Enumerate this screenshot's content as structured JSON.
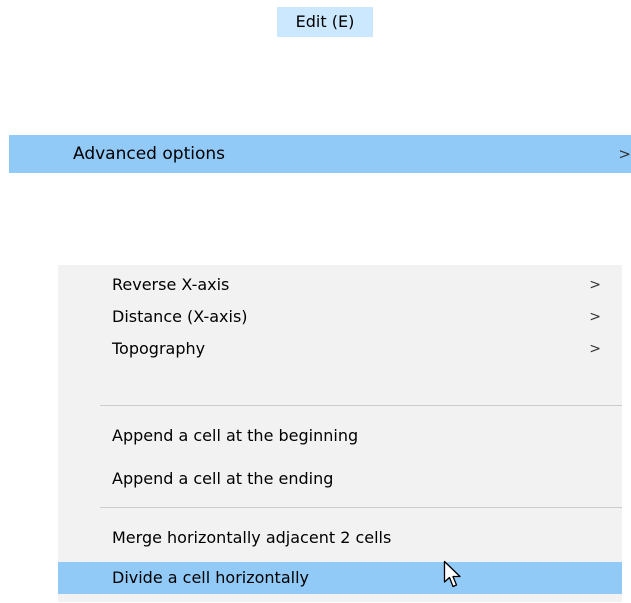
{
  "menubar": {
    "edit_label": "Edit (E)"
  },
  "advanced": {
    "label": "Advanced options",
    "arrow": ">"
  },
  "submenu": {
    "items": [
      {
        "label": "Reverse X-axis",
        "arrow": ">"
      },
      {
        "label": "Distance (X-axis)",
        "arrow": ">"
      },
      {
        "label": "Topography",
        "arrow": ">"
      },
      {
        "label": "Append a cell at the beginning",
        "arrow": ""
      },
      {
        "label": "Append a cell at the ending",
        "arrow": ""
      },
      {
        "label": "Merge horizontally adjacent 2 cells",
        "arrow": ""
      },
      {
        "label": "Divide a cell horizontally",
        "arrow": ""
      }
    ]
  },
  "colors": {
    "menubar_hover": "#cce8ff",
    "row_highlight": "#91c9f7",
    "submenu_background": "#f2f2f2",
    "separator": "#cccccc"
  },
  "icons": {
    "cursor": "mouse-pointer-icon"
  }
}
